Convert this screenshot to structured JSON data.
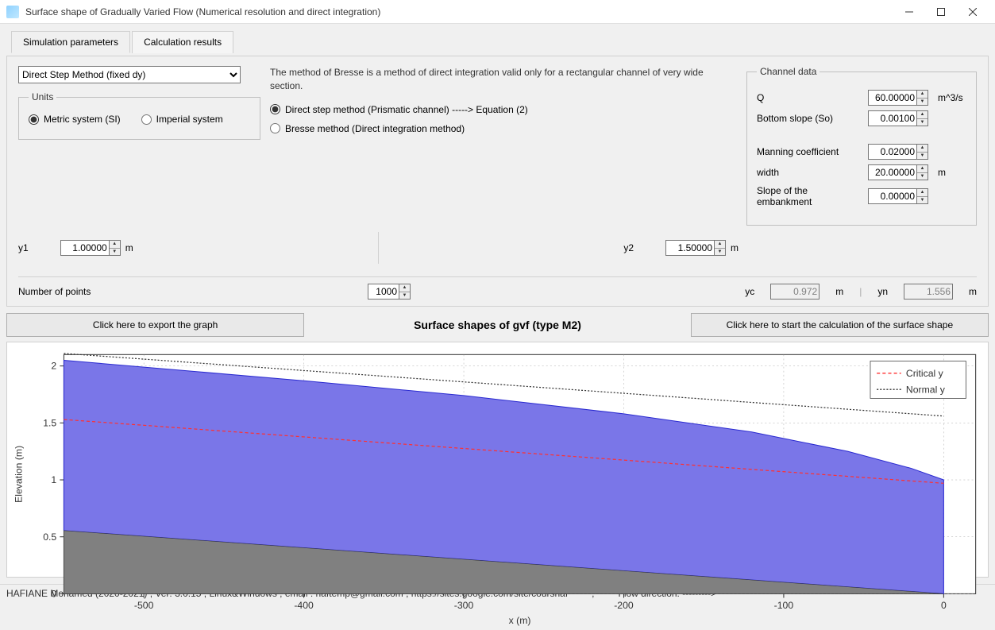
{
  "window": {
    "title": "Surface shape of Gradually Varied Flow (Numerical resolution and direct integration)"
  },
  "tabs": {
    "t1": "Simulation parameters",
    "t2": "Calculation results"
  },
  "method_select": "Direct Step Method (fixed dy)",
  "units": {
    "legend": "Units",
    "metric": "Metric system (SI)",
    "imperial": "Imperial system"
  },
  "help_text": "The method of Bresse is a method of direct integration valid only for a rectangular channel of very wide section.",
  "method_radio": {
    "direct": "Direct step method (Prismatic channel) -----> Equation (2)",
    "bresse": "Bresse method (Direct integration method)"
  },
  "channel": {
    "legend": "Channel data",
    "q_label": "Q",
    "q_val": "60.00000",
    "q_unit": "m^3/s",
    "so_label": "Bottom slope (So)",
    "so_val": "0.00100",
    "n_label": "Manning coefficient",
    "n_val": "0.02000",
    "w_label": "width",
    "w_val": "20.00000",
    "w_unit": "m",
    "emb_label": "Slope of the embankment",
    "emb_val": "0.00000"
  },
  "y1_label": "y1",
  "y1_val": "1.00000",
  "y1_unit": "m",
  "y2_label": "y2",
  "y2_val": "1.50000",
  "y2_unit": "m",
  "np_label": "Number of points",
  "np_val": "1000",
  "yc_label": "yc",
  "yc_val": "0.972",
  "yc_unit": "m",
  "yn_label": "yn",
  "yn_val": "1.556",
  "yn_unit": "m",
  "buttons": {
    "export": "Click here to export the graph",
    "title": "Surface shapes of gvf (type M2)",
    "start": "Click here to start the calculation of the surface shape"
  },
  "status": {
    "left": "HAFIANE Mohamed (2020-2021) ; Ver: 3.0.15 ; Linux&Windows ; email : haftemp@gmail.com ; https://sites.google.com/site/courshaf",
    "sep": ";",
    "flow": "Flow direction: --------->"
  },
  "chart_data": {
    "type": "area",
    "title": "Surface shapes of gvf (type M2)",
    "xlabel": "x (m)",
    "ylabel": "Elevation (m)",
    "xlim": [
      -550,
      20
    ],
    "ylim": [
      0,
      2.1
    ],
    "x_ticks": [
      -500,
      -400,
      -300,
      -200,
      -100,
      0
    ],
    "y_ticks": [
      0,
      0.5,
      1,
      1.5,
      2
    ],
    "legend": [
      "Critical y",
      "Normal y"
    ],
    "series": [
      {
        "name": "Channel bed",
        "kind": "area_bottom",
        "color": "#808080",
        "points": [
          {
            "x": -550,
            "y": 0.555
          },
          {
            "x": 0,
            "y": 0
          }
        ]
      },
      {
        "name": "Water surface",
        "kind": "area_water",
        "color": "#7a76e8",
        "points": [
          {
            "x": -550,
            "y": 2.05
          },
          {
            "x": -400,
            "y": 1.87
          },
          {
            "x": -300,
            "y": 1.74
          },
          {
            "x": -200,
            "y": 1.58
          },
          {
            "x": -120,
            "y": 1.42
          },
          {
            "x": -60,
            "y": 1.25
          },
          {
            "x": -20,
            "y": 1.1
          },
          {
            "x": 0,
            "y": 1.0
          }
        ]
      },
      {
        "name": "Critical y",
        "kind": "line",
        "color": "#ff3030",
        "dash": "4 3",
        "points": [
          {
            "x": -550,
            "y": 1.53
          },
          {
            "x": 0,
            "y": 0.97
          }
        ]
      },
      {
        "name": "Normal y",
        "kind": "line",
        "color": "#333333",
        "dash": "2 2",
        "points": [
          {
            "x": -550,
            "y": 2.11
          },
          {
            "x": 0,
            "y": 1.56
          }
        ]
      }
    ]
  }
}
